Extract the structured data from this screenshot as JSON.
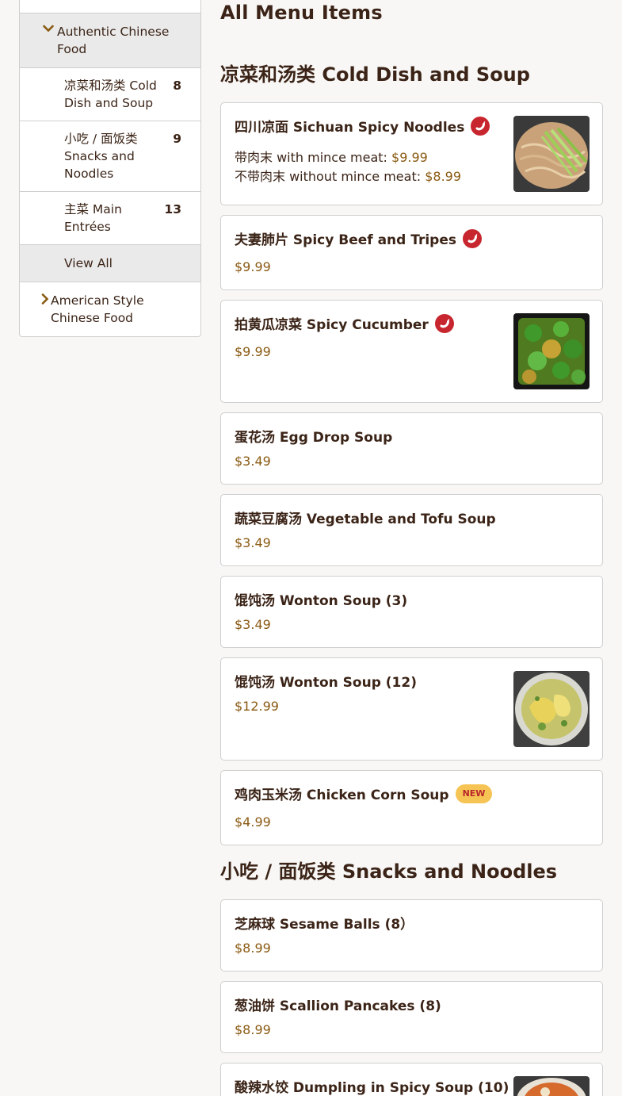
{
  "sidebar": {
    "groups": [
      {
        "label": "Authentic Chinese Food",
        "expanded": true,
        "items": [
          {
            "label": "凉菜和汤类 Cold Dish and Soup",
            "count": "8"
          },
          {
            "label": "小吃 / 面饭类 Snacks and Noodles",
            "count": "9"
          },
          {
            "label": "主菜 Main Entrées",
            "count": "13"
          },
          {
            "label": "View All",
            "count": ""
          }
        ]
      },
      {
        "label": "American Style Chinese Food",
        "expanded": false
      }
    ]
  },
  "page_title": "All Menu Items",
  "sections": [
    {
      "title": "凉菜和汤类 Cold Dish and Soup",
      "items": [
        {
          "name": "四川凉面 Sichuan Spicy Noodles",
          "spicy": true,
          "options": [
            {
              "label": "带肉末 with mince meat:",
              "price": "$9.99"
            },
            {
              "label": "不带肉末 without mince meat:",
              "price": "$8.99"
            }
          ],
          "image": "noodles-with-cucumber"
        },
        {
          "name": "夫妻肺片 Spicy Beef and Tripes",
          "spicy": true,
          "price": "$9.99"
        },
        {
          "name": "拍黄瓜凉菜 Spicy Cucumber",
          "spicy": true,
          "price": "$9.99",
          "image": "green-peppers-dish"
        },
        {
          "name": "蛋花汤 Egg Drop Soup",
          "price": "$3.49"
        },
        {
          "name": "蔬菜豆腐汤 Vegetable and Tofu Soup",
          "price": "$3.49"
        },
        {
          "name": "馄饨汤 Wonton Soup (3)",
          "price": "$3.49"
        },
        {
          "name": "馄饨汤 Wonton Soup (12)",
          "price": "$12.99",
          "image": "wonton-soup-bowl"
        },
        {
          "name": "鸡肉玉米汤 Chicken Corn Soup",
          "badge": "NEW",
          "price": "$4.99"
        }
      ]
    },
    {
      "title": "小吃 / 面饭类 Snacks and Noodles",
      "items": [
        {
          "name": "芝麻球 Sesame Balls (8）",
          "price": "$8.99"
        },
        {
          "name": "葱油饼 Scallion Pancakes (8)",
          "price": "$8.99"
        },
        {
          "name": "酸辣水饺 Dumpling in Spicy Soup (10)",
          "spicy": true,
          "image": "dumpling-soup"
        }
      ]
    }
  ],
  "colors": {
    "text": "#3b2417",
    "price": "#8a5a12",
    "spicy_badge": "#c8262f",
    "new_badge_bg": "#f6c454",
    "new_badge_text": "#b8262b",
    "page_bg": "#f8f7f5",
    "border": "#cfcfcf"
  },
  "icons": {
    "spicy": "chili-pepper-icon",
    "expand": "chevron-down-icon",
    "collapsed": "chevron-right-icon"
  }
}
